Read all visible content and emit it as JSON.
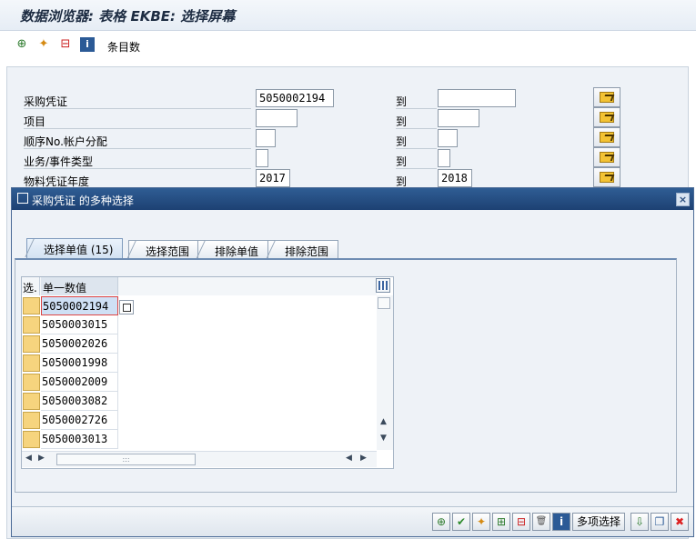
{
  "window": {
    "title": "数据浏览器: 表格 EKBE: 选择屏幕"
  },
  "toolbar": {
    "items": [
      {
        "icon": "execute-icon"
      },
      {
        "icon": "get-variant-icon"
      },
      {
        "icon": "delete-selection-icon"
      },
      {
        "icon": "info-icon"
      }
    ],
    "entries_label": "条目数"
  },
  "selection": {
    "to_label": "到",
    "rows": [
      {
        "label": "采购凭证",
        "from": "5050002194",
        "to": ""
      },
      {
        "label": "项目",
        "from": "",
        "to": ""
      },
      {
        "label": "顺序No.帐户分配",
        "from": "",
        "to": ""
      },
      {
        "label": "业务/事件类型",
        "from": "",
        "to": ""
      },
      {
        "label": "物料凭证年度",
        "from": "2017",
        "to": "2018"
      }
    ]
  },
  "dialog": {
    "title": "采购凭证 的多种选择",
    "close": "×",
    "tabs": [
      {
        "label": "选择单值 (15)",
        "active": true
      },
      {
        "label": "选择范围",
        "active": false
      },
      {
        "label": "排除单值",
        "active": false
      },
      {
        "label": "排除范围",
        "active": false
      }
    ],
    "table": {
      "col_sel": "选.",
      "col_value": "单一数值",
      "rows": [
        "5050002194",
        "5050003015",
        "5050002026",
        "5050001998",
        "5050002009",
        "5050003082",
        "5050002726",
        "5050003013"
      ],
      "scroll_up": "▲",
      "scroll_down": "▼",
      "scroll_left": "◀",
      "scroll_right": "▶",
      "hthumb_grip": ":::"
    },
    "footer": {
      "buttons": [
        {
          "icon": "execute-icon",
          "glyph": "⊕"
        },
        {
          "icon": "check-icon",
          "glyph": "✔"
        },
        {
          "icon": "variant-icon",
          "glyph": "✦"
        },
        {
          "icon": "insert-row-icon",
          "glyph": "⊞"
        },
        {
          "icon": "delete-row-icon",
          "glyph": "⊟"
        },
        {
          "icon": "trash-icon",
          "glyph": "🗑"
        },
        {
          "icon": "info-icon",
          "glyph": "i"
        }
      ],
      "multi_select_label": "多项选择",
      "trailing_buttons": [
        {
          "icon": "import-icon",
          "glyph": "⇩"
        },
        {
          "icon": "upload-clipboard-icon",
          "glyph": "❐"
        },
        {
          "icon": "cancel-icon",
          "glyph": "✖"
        }
      ]
    }
  }
}
